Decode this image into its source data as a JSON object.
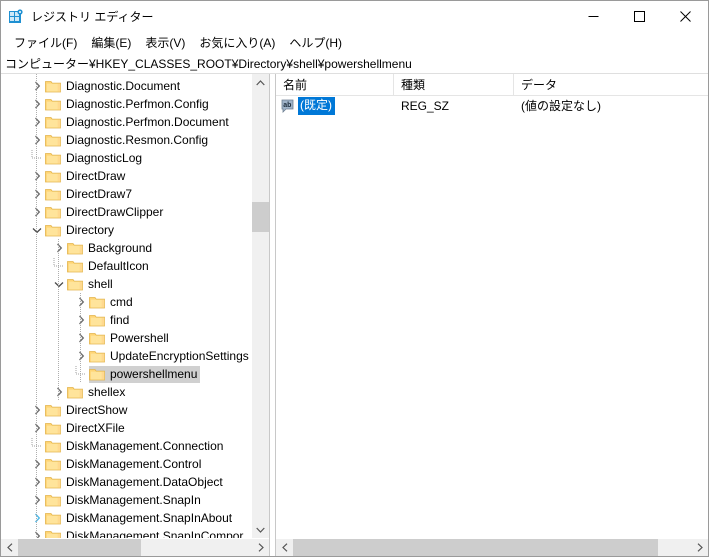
{
  "window": {
    "title": "レジストリ エディター",
    "app_icon": "registry-editor-icon",
    "controls": {
      "minimize": "—",
      "maximize": "☐",
      "close": "✕"
    }
  },
  "menubar": {
    "items": [
      {
        "label": "ファイル(F)",
        "name": "menu-file"
      },
      {
        "label": "編集(E)",
        "name": "menu-edit"
      },
      {
        "label": "表示(V)",
        "name": "menu-view"
      },
      {
        "label": "お気に入り(A)",
        "name": "menu-favorites"
      },
      {
        "label": "ヘルプ(H)",
        "name": "menu-help"
      }
    ]
  },
  "address": {
    "path": "コンピューター¥HKEY_CLASSES_ROOT¥Directory¥shell¥powershellmenu"
  },
  "tree": {
    "nodes": [
      {
        "label": "Diagnostic.Document",
        "level": 1,
        "state": "collapsed",
        "selected": false
      },
      {
        "label": "Diagnostic.Perfmon.Config",
        "level": 1,
        "state": "collapsed",
        "selected": false
      },
      {
        "label": "Diagnostic.Perfmon.Document",
        "level": 1,
        "state": "collapsed",
        "selected": false
      },
      {
        "label": "Diagnostic.Resmon.Config",
        "level": 1,
        "state": "collapsed",
        "selected": false
      },
      {
        "label": "DiagnosticLog",
        "level": 1,
        "state": "leaf",
        "selected": false
      },
      {
        "label": "DirectDraw",
        "level": 1,
        "state": "collapsed",
        "selected": false
      },
      {
        "label": "DirectDraw7",
        "level": 1,
        "state": "collapsed",
        "selected": false
      },
      {
        "label": "DirectDrawClipper",
        "level": 1,
        "state": "collapsed",
        "selected": false
      },
      {
        "label": "Directory",
        "level": 1,
        "state": "expanded",
        "selected": false
      },
      {
        "label": "Background",
        "level": 2,
        "state": "collapsed",
        "selected": false
      },
      {
        "label": "DefaultIcon",
        "level": 2,
        "state": "leaf",
        "selected": false
      },
      {
        "label": "shell",
        "level": 2,
        "state": "expanded",
        "selected": false
      },
      {
        "label": "cmd",
        "level": 3,
        "state": "collapsed",
        "selected": false
      },
      {
        "label": "find",
        "level": 3,
        "state": "collapsed",
        "selected": false
      },
      {
        "label": "Powershell",
        "level": 3,
        "state": "collapsed",
        "selected": false
      },
      {
        "label": "UpdateEncryptionSettings",
        "level": 3,
        "state": "collapsed",
        "selected": false
      },
      {
        "label": "powershellmenu",
        "level": 3,
        "state": "leaf",
        "selected": true
      },
      {
        "label": "shellex",
        "level": 2,
        "state": "collapsed",
        "selected": false
      },
      {
        "label": "DirectShow",
        "level": 1,
        "state": "collapsed",
        "selected": false
      },
      {
        "label": "DirectXFile",
        "level": 1,
        "state": "collapsed",
        "selected": false
      },
      {
        "label": "DiskManagement.Connection",
        "level": 1,
        "state": "leaf",
        "selected": false
      },
      {
        "label": "DiskManagement.Control",
        "level": 1,
        "state": "collapsed",
        "selected": false
      },
      {
        "label": "DiskManagement.DataObject",
        "level": 1,
        "state": "collapsed",
        "selected": false
      },
      {
        "label": "DiskManagement.SnapIn",
        "level": 1,
        "state": "collapsed",
        "selected": false
      },
      {
        "label": "DiskManagement.SnapInAbout",
        "level": 1,
        "state": "collapsed-hover",
        "selected": false
      },
      {
        "label": "DiskManagement.SnapInCompor",
        "level": 1,
        "state": "collapsed",
        "selected": false
      }
    ],
    "scroll": {
      "up_arrow": "⌃",
      "down_arrow": "⌄",
      "left_arrow": "‹",
      "right_arrow": "›"
    }
  },
  "listview": {
    "columns": [
      {
        "label": "名前",
        "name": "column-name"
      },
      {
        "label": "種類",
        "name": "column-type"
      },
      {
        "label": "データ",
        "name": "column-data"
      }
    ],
    "rows": [
      {
        "name": "(既定)",
        "type": "REG_SZ",
        "data": "(値の設定なし)",
        "icon": "ab-string-icon",
        "selected": true
      }
    ],
    "scroll": {
      "left_arrow": "‹",
      "right_arrow": "›"
    }
  },
  "colors": {
    "selection_active": "#0078d7",
    "selection_inactive": "#d0d0d0",
    "folder": "#ffe49b",
    "scrollbar_thumb": "#cdcdcd",
    "scrollbar_track": "#f0f0f0"
  }
}
